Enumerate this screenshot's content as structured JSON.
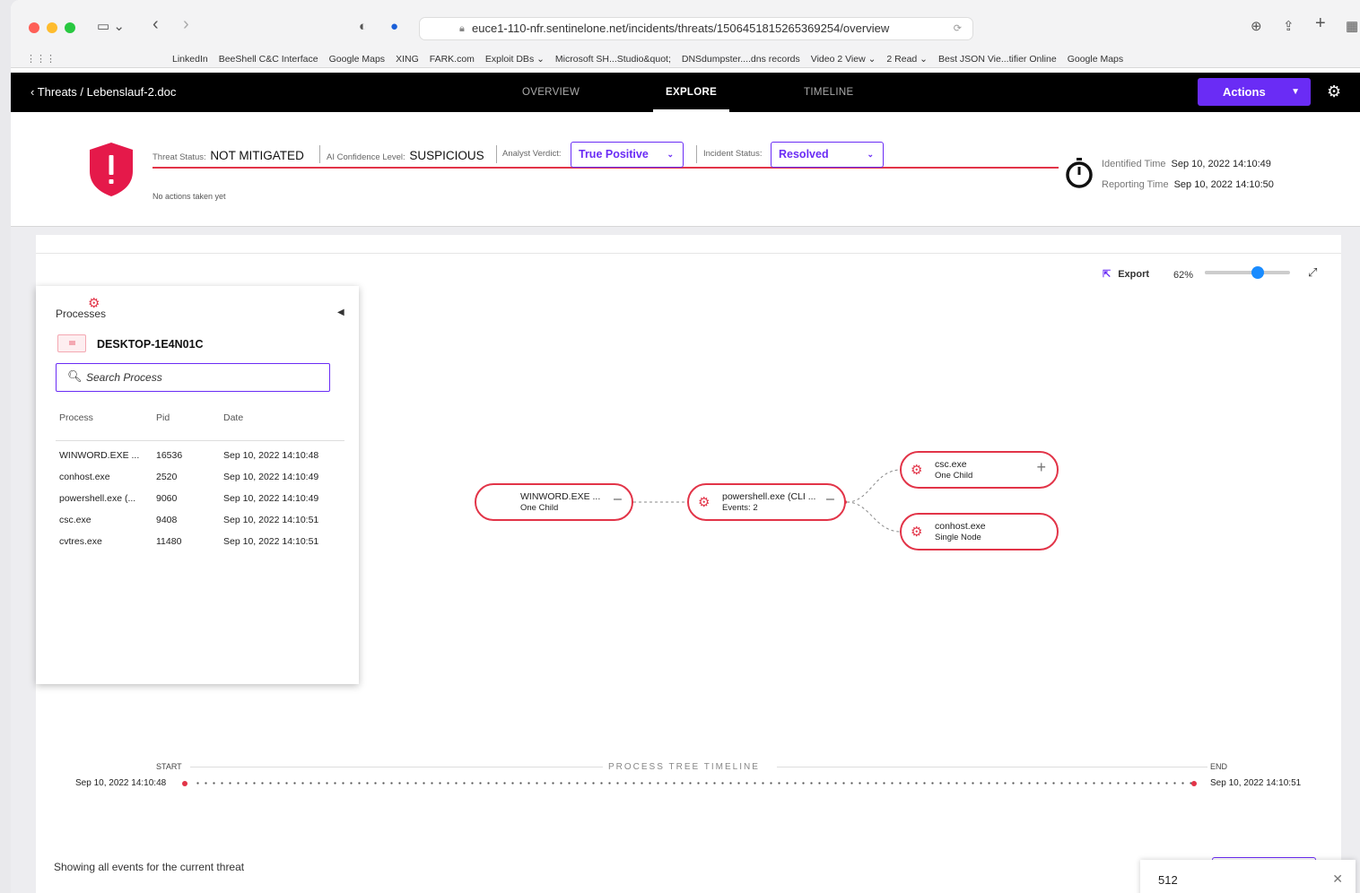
{
  "browser": {
    "url": "euce1-110-nfr.sentinelone.net/incidents/threats/1506451815265369254/overview",
    "bookmarks": [
      "LinkedIn",
      "BeeShell C&C Interface",
      "Google Maps",
      "XING",
      "FARK.com",
      "Exploit DBs ⌄",
      "Microsoft SH...Studio&quot;",
      "DNSdumpster....dns records",
      "Video 2 View ⌄",
      "2 Read ⌄",
      "Best JSON Vie...tifier Online",
      "Google Maps"
    ]
  },
  "nav": {
    "breadcrumb": "Threats / Lebenslauf-2.doc",
    "tabs": [
      "OVERVIEW",
      "EXPLORE",
      "TIMELINE"
    ],
    "active_tab": "EXPLORE",
    "actions_label": "Actions"
  },
  "threat": {
    "status_label": "Threat Status:",
    "status_value": "NOT MITIGATED",
    "confidence_label": "AI Confidence Level:",
    "confidence_value": "SUSPICIOUS",
    "verdict_label": "Analyst Verdict:",
    "verdict_value": "True Positive",
    "incident_label": "Incident Status:",
    "incident_value": "Resolved",
    "no_actions": "No actions taken yet",
    "identified_label": "Identified Time",
    "identified_value": "Sep 10, 2022 14:10:49",
    "reporting_label": "Reporting Time",
    "reporting_value": "Sep 10, 2022 14:10:50"
  },
  "explore": {
    "export_label": "Export",
    "zoom_percent": "62%",
    "zoom_level": 0.62
  },
  "processes": {
    "title": "Processes",
    "host": "DESKTOP-1E4N01C",
    "search_placeholder": "Search Process",
    "columns": [
      "Process",
      "Pid",
      "Date"
    ],
    "rows": [
      {
        "process": "WINWORD.EXE ...",
        "pid": "16536",
        "date": "Sep 10, 2022 14:10:48"
      },
      {
        "process": "conhost.exe",
        "pid": "2520",
        "date": "Sep 10, 2022 14:10:49"
      },
      {
        "process": "powershell.exe (...",
        "pid": "9060",
        "date": "Sep 10, 2022 14:10:49"
      },
      {
        "process": "csc.exe",
        "pid": "9408",
        "date": "Sep 10, 2022 14:10:51"
      },
      {
        "process": "cvtres.exe",
        "pid": "11480",
        "date": "Sep 10, 2022 14:10:51"
      }
    ]
  },
  "graph": {
    "nodes": [
      {
        "name": "WINWORD.EXE ...",
        "sub": "One Child"
      },
      {
        "name": "powershell.exe (CLI ...",
        "sub": "Events: 2"
      },
      {
        "name": "csc.exe",
        "sub": "One Child"
      },
      {
        "name": "conhost.exe",
        "sub": "Single Node"
      }
    ]
  },
  "timeline": {
    "title": "PROCESS TREE TIMELINE",
    "start_label": "START",
    "start_date": "Sep 10, 2022 14:10:48",
    "end_label": "END",
    "end_date": "Sep 10, 2022 14:10:51"
  },
  "events": {
    "caption": "Showing all events for the current threat"
  },
  "popup": {
    "value": "512"
  },
  "colors": {
    "accent": "#6a2cf5",
    "threat_red": "#e23448",
    "nav_bg": "#000000",
    "slider_knob": "#1a8cff"
  }
}
